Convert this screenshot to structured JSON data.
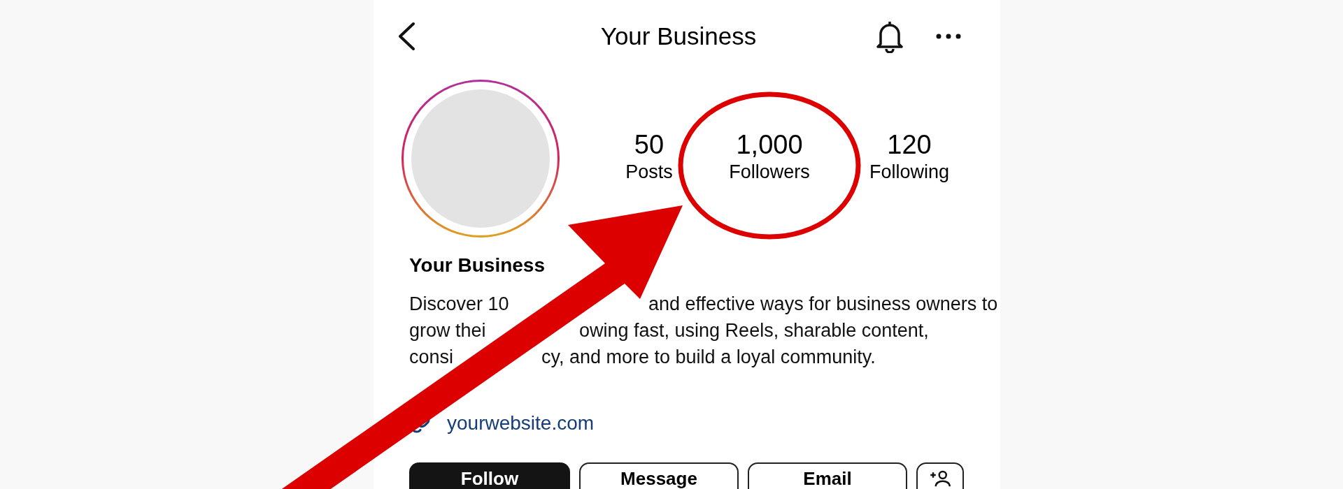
{
  "header": {
    "title": "Your Business"
  },
  "stats": [
    {
      "value": "50",
      "label": "Posts",
      "highlighted": false
    },
    {
      "value": "1,000",
      "label": "Followers",
      "highlighted": true
    },
    {
      "value": "120",
      "label": "Following",
      "highlighted": false
    }
  ],
  "profile": {
    "name": "Your Business",
    "bio_lines": [
      [
        "Discover 10",
        "and effective ways for business owners to"
      ],
      [
        "grow thei",
        "owing fast, using Reels, sharable content,"
      ],
      [
        "consi",
        "cy, and more to build a loyal community."
      ]
    ],
    "link": "yourwebsite.com"
  },
  "buttons": [
    {
      "kind": "primary",
      "label": "Follow"
    },
    {
      "kind": "secondary",
      "label": "Message"
    },
    {
      "kind": "secondary",
      "label": "Email"
    },
    {
      "kind": "add-person"
    }
  ]
}
